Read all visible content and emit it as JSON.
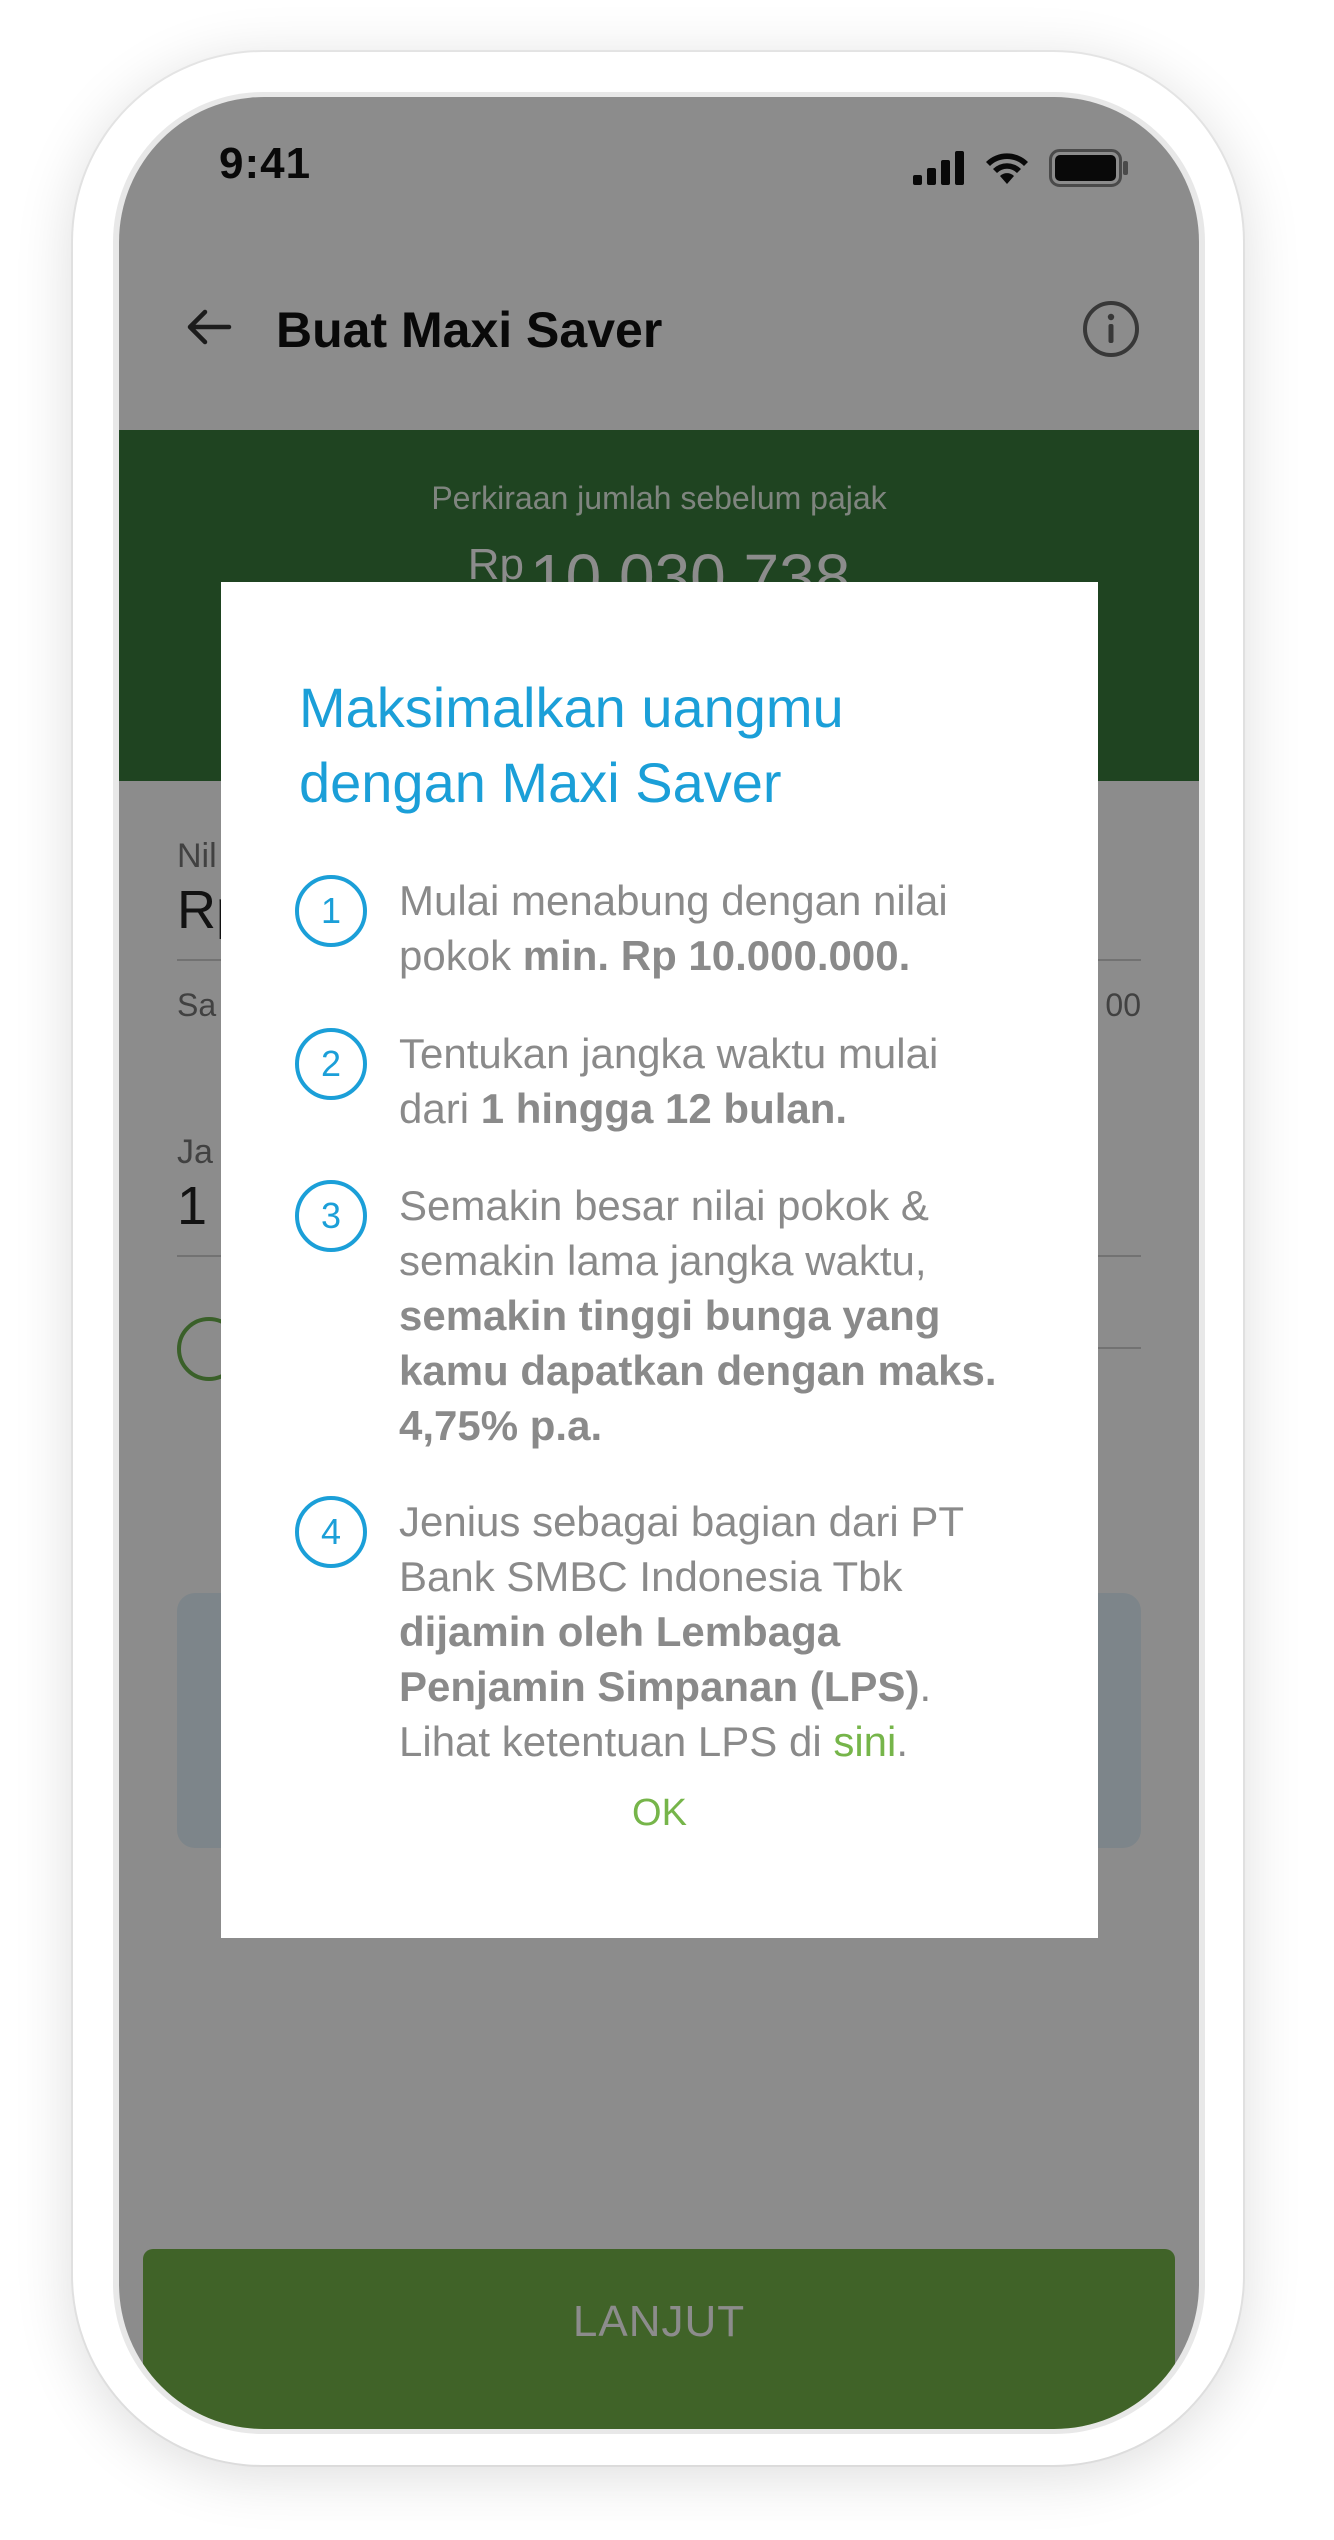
{
  "status_bar": {
    "time": "9:41",
    "icons": [
      "signal-icon",
      "wifi-icon",
      "battery-icon"
    ]
  },
  "header": {
    "title": "Buat Maxi Saver",
    "back_icon": "arrow-left-icon",
    "info_icon": "info-circle-icon"
  },
  "banner": {
    "label": "Perkiraan jumlah sebelum pajak",
    "currency": "Rp",
    "amount": "10.030.738",
    "color": "#3a7d3c"
  },
  "form": {
    "amount_label_partial": "Nil",
    "amount_value_partial": "Rp",
    "hint_left_partial": "Sa",
    "hint_right_partial": "00",
    "period_label_partial": "Ja",
    "period_value_partial": "1"
  },
  "cta": {
    "label": "LANJUT",
    "color": "#76b54a"
  },
  "dialog": {
    "title_line1": "Maksimalkan uangmu",
    "title_line2": "dengan Maxi Saver",
    "accent_color": "#1b9fd8",
    "steps": [
      {
        "number": "1",
        "text_a": "Mulai menabung dengan nilai pokok ",
        "bold_a": "min. Rp 10.000.000."
      },
      {
        "number": "2",
        "text_a": "Tentukan jangka waktu mulai dari ",
        "bold_a": "1 hingga 12 bulan."
      },
      {
        "number": "3",
        "text_a": "Semakin besar nilai pokok & semakin lama jangka waktu, ",
        "bold_a": "semakin tinggi bunga yang kamu dapatkan dengan maks. 4,75% p.a."
      },
      {
        "number": "4",
        "text_a": "Jenius sebagai bagian dari PT Bank SMBC Indonesia Tbk ",
        "bold_a": "dijamin oleh Lembaga Penjamin Simpanan (LPS)",
        "text_b": ". Lihat ketentuan LPS di ",
        "link": "sini",
        "text_c": "."
      }
    ],
    "ok_label": "OK",
    "link_color": "#76b54a"
  }
}
